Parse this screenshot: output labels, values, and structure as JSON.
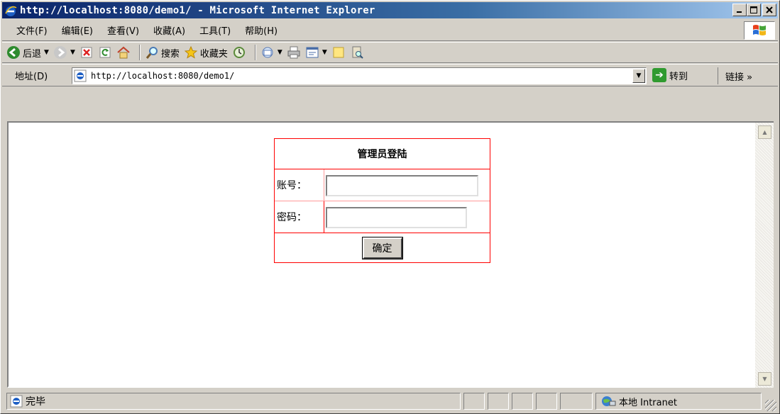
{
  "window": {
    "title": "http://localhost:8080/demo1/ - Microsoft Internet Explorer",
    "min_icon": "minimize-icon",
    "max_icon": "maximize-icon",
    "close_icon": "close-icon"
  },
  "menu": {
    "items": [
      "文件(F)",
      "编辑(E)",
      "查看(V)",
      "收藏(A)",
      "工具(T)",
      "帮助(H)"
    ]
  },
  "toolbar": {
    "back_label": "后退",
    "search_label": "搜索",
    "favorites_label": "收藏夹"
  },
  "address": {
    "label": "地址(D)",
    "url": "http://localhost:8080/demo1/",
    "go_label": "转到",
    "links_label": "链接 »"
  },
  "login": {
    "title": "管理员登陆",
    "username_label": "账号：",
    "password_label": "密码：",
    "username_value": "",
    "password_value": "",
    "submit_label": "确定"
  },
  "status": {
    "text": "完毕",
    "zone": "本地 Intranet"
  },
  "colors": {
    "titlebar_start": "#0a246a",
    "titlebar_end": "#a6caf0",
    "table_border": "#ff0000",
    "chrome": "#d4d0c8"
  }
}
